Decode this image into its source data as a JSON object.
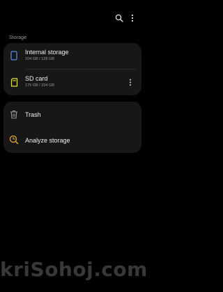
{
  "header": {
    "search_icon": "search-icon",
    "more_icon": "more-vert-icon"
  },
  "section": {
    "label": "Storage"
  },
  "storage_items": [
    {
      "title": "Internal storage",
      "subtitle": "104 GB / 128 GB",
      "icon": "phone-icon",
      "color": "#4a90e2"
    },
    {
      "title": "SD card",
      "subtitle": "175 GB / 234 GB",
      "icon": "sd-card-icon",
      "color": "#e8e04a"
    }
  ],
  "tools": [
    {
      "title": "Trash",
      "icon": "trash-icon"
    },
    {
      "title": "Analyze storage",
      "icon": "analyze-storage-icon",
      "color": "#e8a23a"
    }
  ],
  "watermark": {
    "text": "kriSohoj.com"
  }
}
